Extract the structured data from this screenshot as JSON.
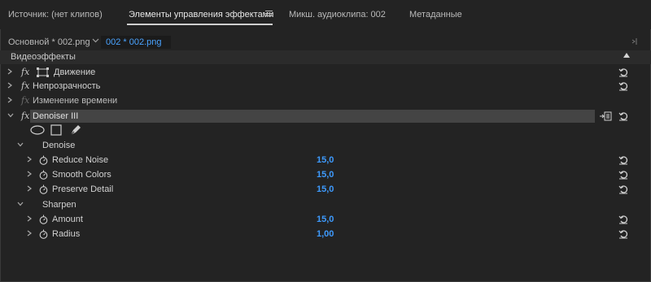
{
  "tabs": [
    {
      "label": "Источник: (нет клипов)"
    },
    {
      "label": "Элементы управления эффектами"
    },
    {
      "label": "Микш. аудиоклипа: 002"
    },
    {
      "label": "Метаданные"
    }
  ],
  "header": {
    "master_clip": "Основной * 002.png",
    "selected_clip": "002 * 002.png"
  },
  "section": {
    "title": "Видеоэффекты"
  },
  "effects": {
    "motion": "Движение",
    "opacity": "Непрозрачность",
    "time_remap": "Изменение времени",
    "denoiser": "Denoiser III"
  },
  "icons": {
    "fx": "fx"
  },
  "groups": {
    "denoise": "Denoise",
    "sharpen": "Sharpen"
  },
  "params": {
    "reduce_noise": {
      "label": "Reduce Noise",
      "value": "15,0"
    },
    "smooth_colors": {
      "label": "Smooth Colors",
      "value": "15,0"
    },
    "preserve_detail": {
      "label": "Preserve Detail",
      "value": "15,0"
    },
    "amount": {
      "label": "Amount",
      "value": "15,0"
    },
    "radius": {
      "label": "Radius",
      "value": "1,00"
    }
  },
  "colors": {
    "accent": "#3e9bff",
    "bg": "#232323"
  }
}
